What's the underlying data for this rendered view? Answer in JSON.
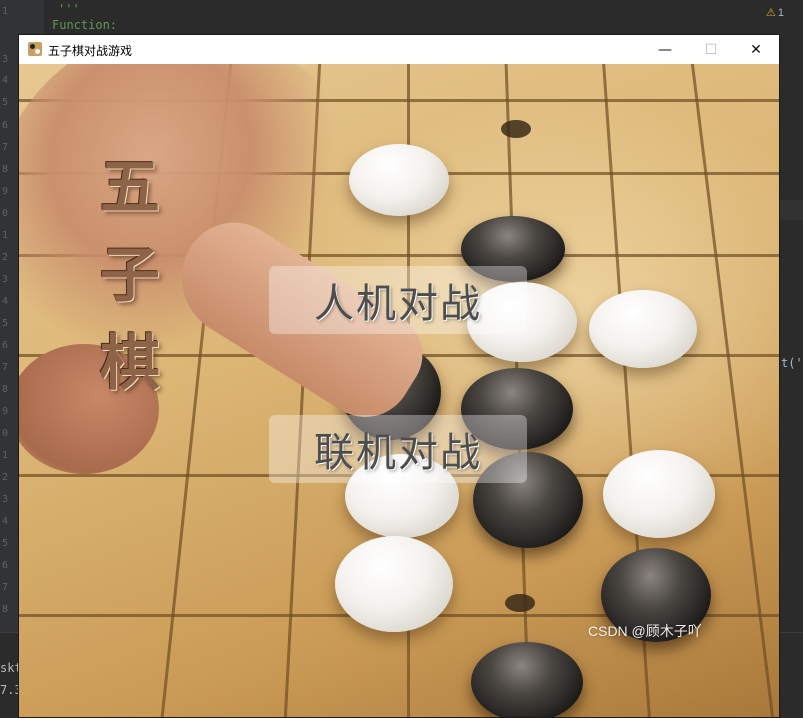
{
  "ide": {
    "line_numbers": [
      "1",
      "3",
      "4",
      "5",
      "6",
      "7",
      "8",
      "9",
      "0",
      "1",
      "2",
      "3",
      "4",
      "5",
      "6",
      "7",
      "8",
      "9",
      "0",
      "1",
      "2",
      "3",
      "4",
      "5",
      "6",
      "7",
      "8",
      "9",
      "0",
      "1",
      "2"
    ],
    "docstring_open": "'''",
    "code_line": "Function:",
    "warning_count": "1",
    "side_fragment": "t('",
    "bottom_fragments": [
      "skt",
      "7.3"
    ]
  },
  "window": {
    "title": "五子棋对战游戏",
    "controls": {
      "minimize": "—",
      "maximize": "☐",
      "close": "✕"
    }
  },
  "game": {
    "logo_chars": [
      "五",
      "子",
      "棋"
    ],
    "menu": {
      "vs_ai_label": "人机对战",
      "vs_online_label": "联机对战"
    }
  },
  "watermark": "CSDN @顾木子吖",
  "colors": {
    "board": "#d8b67a",
    "grid": "#6f4d22",
    "button_overlay": "rgba(255,255,255,0.35)",
    "button_text": "#4d4d4d"
  }
}
